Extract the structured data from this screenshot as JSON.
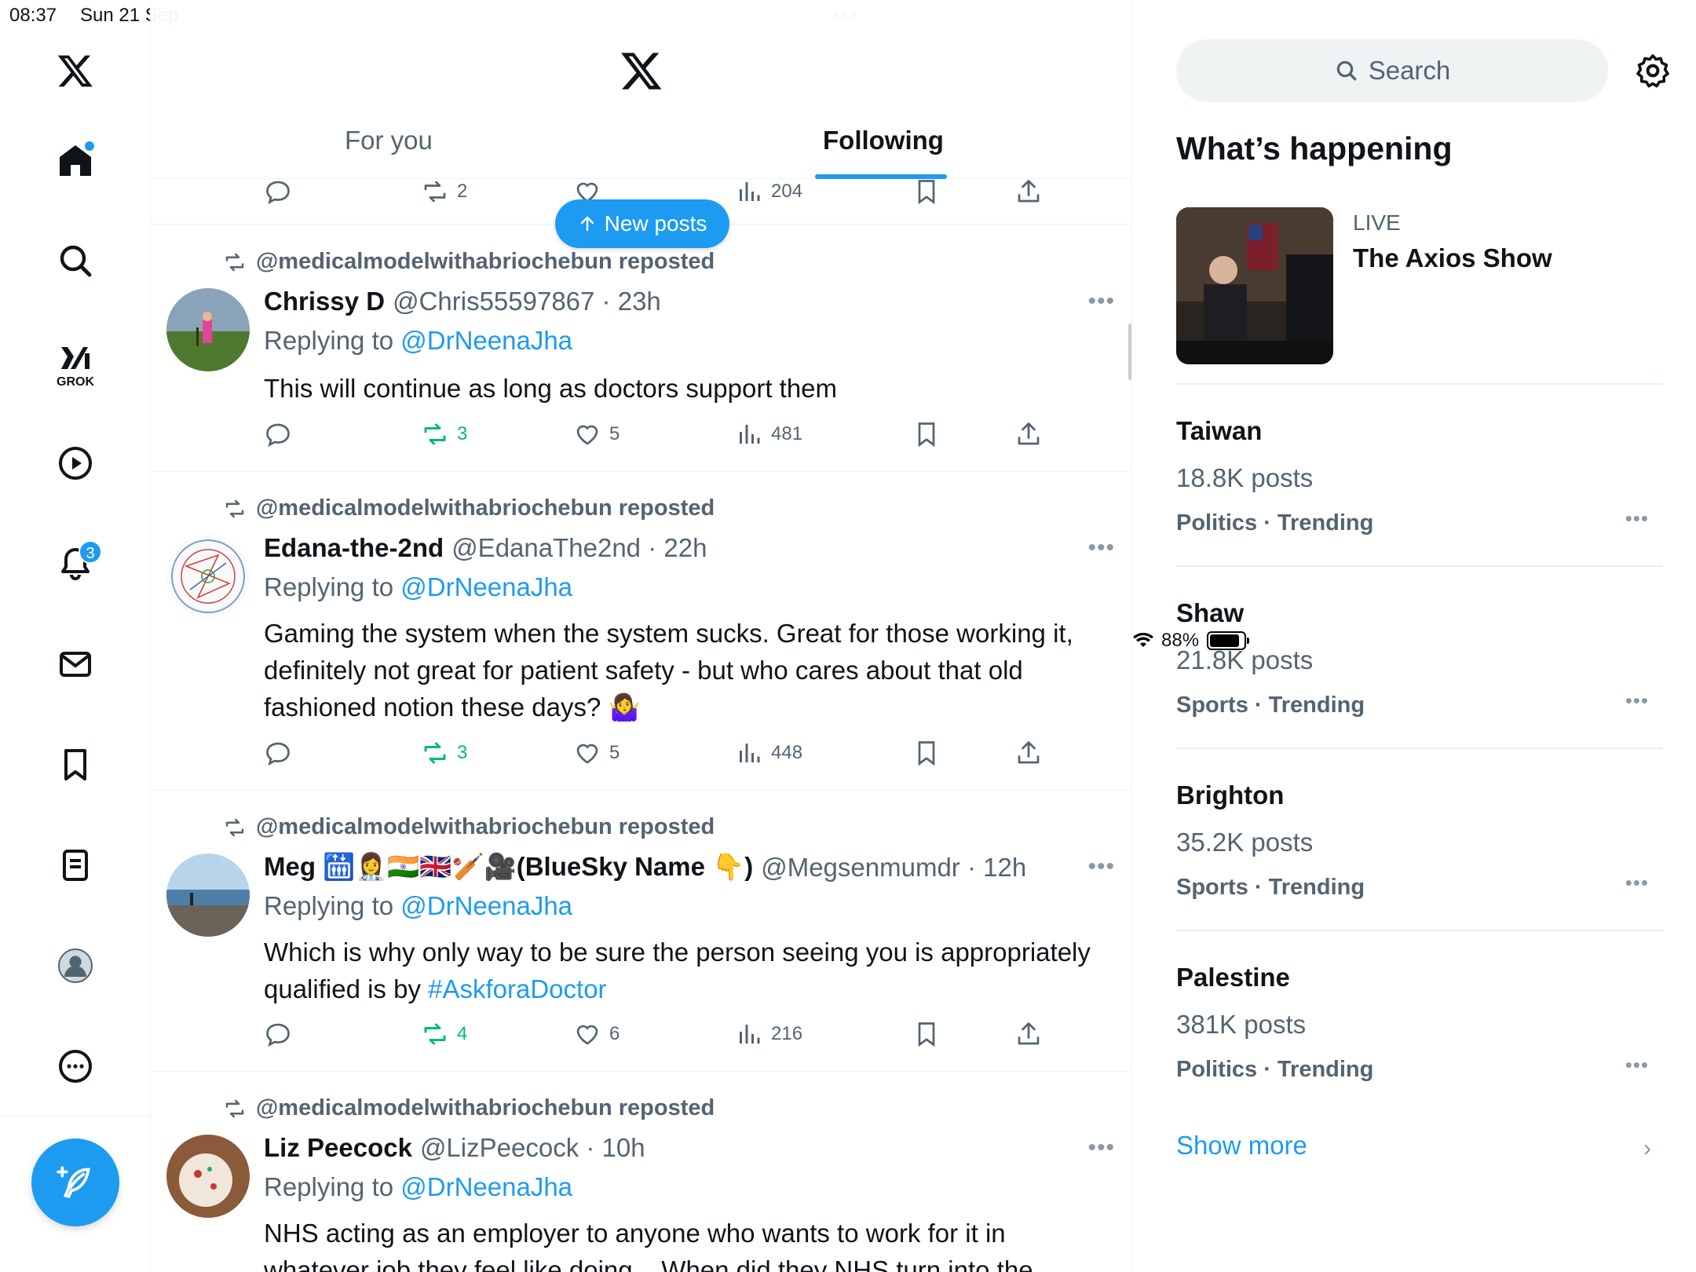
{
  "status": {
    "time": "08:37",
    "date": "Sun 21 Sep",
    "battery": "88%",
    "battery_level": 0.88
  },
  "nav": {
    "grok_label": "GROK",
    "notifications_badge": "3"
  },
  "header": {
    "tabs": [
      {
        "label": "For you"
      },
      {
        "label": "Following"
      }
    ],
    "active_tab": "Following",
    "new_posts_label": "New posts"
  },
  "partial_tweet": {
    "reposts": "2",
    "views": "204"
  },
  "tweets": [
    {
      "repost_by": "@medicalmodelwithabriochebun reposted",
      "name": "Chrissy D",
      "handle": "@Chris55597867 · 23h",
      "replying_prefix": "Replying to ",
      "replying_to": "@DrNeenaJha",
      "text": "This will continue as long as doctors support them",
      "reposts": "3",
      "likes": "5",
      "views": "481"
    },
    {
      "repost_by": "@medicalmodelwithabriochebun reposted",
      "name": "Edana-the-2nd",
      "handle": "@EdanaThe2nd · 22h",
      "replying_prefix": "Replying to ",
      "replying_to": "@DrNeenaJha",
      "text": "Gaming the system when the system sucks. Great for those working it, definitely not great for patient safety - but who cares about that old fashioned notion these days? 🤷‍♀️",
      "reposts": "3",
      "likes": "5",
      "views": "448"
    },
    {
      "repost_by": "@medicalmodelwithabriochebun reposted",
      "name": "Meg 🛗👩‍⚕️🇮🇳🇬🇧🏏🎥(BlueSky Name 👇)",
      "handle": "@Megsenmumdr · 12h",
      "replying_prefix": "Replying to ",
      "replying_to": "@DrNeenaJha",
      "text_before": "Which is why only way to be sure the person seeing you is appropriately qualified is by ",
      "text_link": "#AskforaDoctor",
      "reposts": "4",
      "likes": "6",
      "views": "216"
    },
    {
      "repost_by": "@medicalmodelwithabriochebun reposted",
      "name": "Liz Peecock",
      "handle": "@LizPeecock · 10h",
      "replying_prefix": "Replying to ",
      "replying_to": "@DrNeenaJha",
      "text": "NHS acting as an employer to anyone who wants to work for it in whatever job they feel like doing... When did they NHS turn into the"
    }
  ],
  "sidebar": {
    "search_placeholder": "Search",
    "whats_happening": "What’s happening",
    "live": {
      "label": "LIVE",
      "title": "The Axios Show"
    },
    "trends": [
      {
        "name": "Taiwan",
        "count": "18.8K posts",
        "category": "Politics · Trending"
      },
      {
        "name": "Shaw",
        "count": "21.8K posts",
        "category": "Sports · Trending"
      },
      {
        "name": "Brighton",
        "count": "35.2K posts",
        "category": "Sports · Trending"
      },
      {
        "name": "Palestine",
        "count": "381K posts",
        "category": "Politics · Trending"
      }
    ],
    "show_more": "Show more"
  },
  "colors": {
    "accent": "#1d9bf0",
    "repost_green": "#00ba7c",
    "muted": "#536471"
  }
}
